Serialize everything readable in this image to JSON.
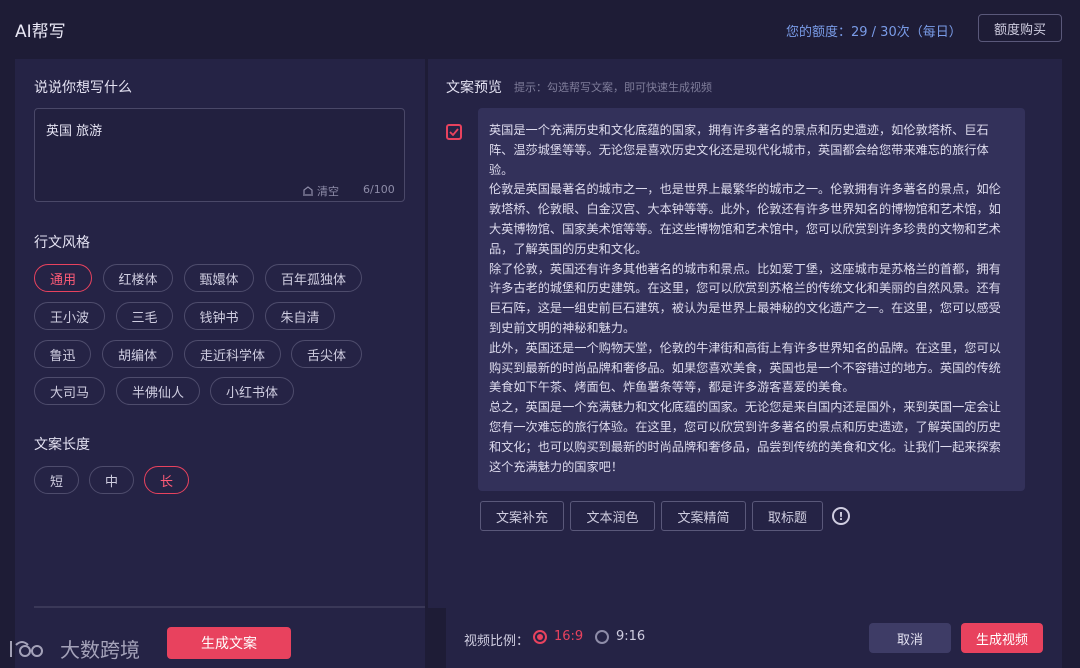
{
  "header": {
    "title": "AI帮写",
    "quota_text": "您的额度：29 / 30次（每日）",
    "buy_button": "额度购买"
  },
  "left": {
    "prompt_title": "说说你想写什么",
    "topic_value": "英国 旅游",
    "clear_label": "清空",
    "char_count": "6/100",
    "style_title": "行文风格",
    "styles": [
      "通用",
      "红楼体",
      "甄嬛体",
      "百年孤独体",
      "王小波",
      "三毛",
      "钱钟书",
      "朱自清",
      "鲁迅",
      "胡编体",
      "走近科学体",
      "舌尖体",
      "大司马",
      "半佛仙人",
      "小红书体"
    ],
    "selected_style": "通用",
    "length_title": "文案长度",
    "lengths": [
      "短",
      "中",
      "长"
    ],
    "selected_length": "长",
    "generate_button": "生成文案",
    "watermark_text": "大数跨境"
  },
  "preview": {
    "title": "文案预览",
    "hint": "提示：勾选帮写文案，即可快速生成视频",
    "checked": true,
    "paragraphs": [
      "英国是一个充满历史和文化底蕴的国家，拥有许多著名的景点和历史遗迹，如伦敦塔桥、巨石阵、温莎城堡等等。无论您是喜欢历史文化还是现代化城市，英国都会给您带来难忘的旅行体验。",
      "伦敦是英国最著名的城市之一，也是世界上最繁华的城市之一。伦敦拥有许多著名的景点，如伦敦塔桥、伦敦眼、白金汉宫、大本钟等等。此外，伦敦还有许多世界知名的博物馆和艺术馆，如大英博物馆、国家美术馆等等。在这些博物馆和艺术馆中，您可以欣赏到许多珍贵的文物和艺术品，了解英国的历史和文化。",
      "除了伦敦，英国还有许多其他著名的城市和景点。比如爱丁堡，这座城市是苏格兰的首都，拥有许多古老的城堡和历史建筑。在这里，您可以欣赏到苏格兰的传统文化和美丽的自然风景。还有巨石阵，这是一组史前巨石建筑，被认为是世界上最神秘的文化遗产之一。在这里，您可以感受到史前文明的神秘和魅力。",
      "此外，英国还是一个购物天堂，伦敦的牛津街和高街上有许多世界知名的品牌。在这里，您可以购买到最新的时尚品牌和奢侈品。如果您喜欢美食，英国也是一个不容错过的地方。英国的传统美食如下午茶、烤面包、炸鱼薯条等等，都是许多游客喜爱的美食。",
      "总之，英国是一个充满魅力和文化底蕴的国家。无论您是来自国内还是国外，来到英国一定会让您有一次难忘的旅行体验。在这里，您可以欣赏到许多著名的景点和历史遗迹，了解英国的历史和文化；也可以购买到最新的时尚品牌和奢侈品，品尝到传统的美食和文化。让我们一起来探索这个充满魅力的国家吧！"
    ],
    "actions": [
      "文案补充",
      "文本润色",
      "文案精简",
      "取标题"
    ]
  },
  "footer": {
    "ratio_label": "视频比例：",
    "ratios": [
      "16:9",
      "9:16"
    ],
    "selected_ratio": "16:9",
    "cancel_button": "取消",
    "generate_video_button": "生成视频"
  },
  "colors": {
    "accent": "#e8425e",
    "quota_blue": "#7a9ce8",
    "background": "#1e1c36",
    "panel": "#252345"
  }
}
